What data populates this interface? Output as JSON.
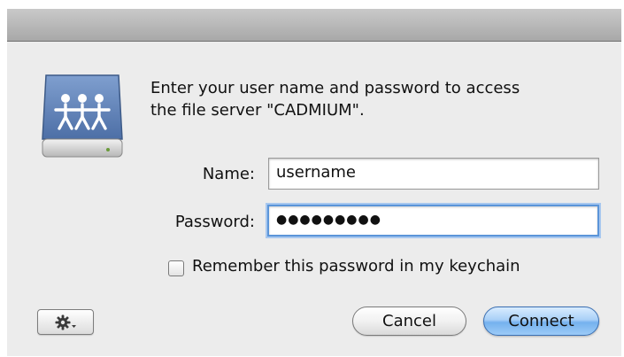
{
  "dialog": {
    "message": "Enter your user name and password to access\nthe file server \"CADMIUM\".",
    "icon": "network-server-icon"
  },
  "form": {
    "name_label": "Name:",
    "name_value": "username",
    "password_label": "Password:",
    "password_masked": "●●●●●●●●●",
    "remember_label": "Remember this password in my keychain",
    "remember_checked": false
  },
  "buttons": {
    "action_menu_icon": "gear-icon",
    "cancel_label": "Cancel",
    "connect_label": "Connect"
  },
  "colors": {
    "window_bg": "#ececec",
    "default_button": "#75b1ee",
    "focus_ring": "#5b95d9"
  }
}
